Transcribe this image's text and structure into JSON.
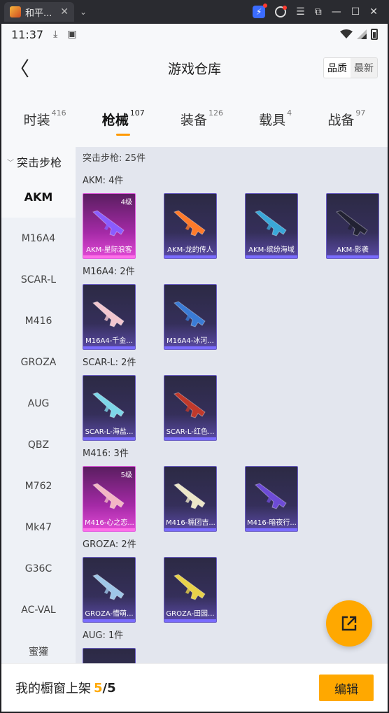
{
  "window": {
    "tab_title": "和平...",
    "tab_close": "✕",
    "tab_dropdown": "⌄"
  },
  "status_bar": {
    "time": "11:37"
  },
  "header": {
    "title": "游戏仓库",
    "back_glyph": "〈",
    "sort_options": [
      "品质",
      "最新"
    ],
    "sort_active": "品质"
  },
  "categories": [
    {
      "label": "时装",
      "count": "416"
    },
    {
      "label": "枪械",
      "count": "107",
      "active": true
    },
    {
      "label": "装备",
      "count": "126"
    },
    {
      "label": "载具",
      "count": "4"
    },
    {
      "label": "战备",
      "count": "97"
    }
  ],
  "sidebar": {
    "group": "突击步枪",
    "group_chevron": "﹀",
    "items": [
      "AKM",
      "M16A4",
      "SCAR-L",
      "M416",
      "GROZA",
      "AUG",
      "QBZ",
      "M762",
      "Mk47",
      "G36C",
      "AC-VAL",
      "蜜獾"
    ],
    "active": "AKM"
  },
  "content": {
    "section_title": "突击步枪: 25件",
    "groups": [
      {
        "title": "AKM: 4件",
        "cards": [
          {
            "name": "AKM-星际浪客",
            "level": "4级",
            "rarity": "pink",
            "gun_color": "#8a5cff"
          },
          {
            "name": "AKM-龙的传人",
            "level": "",
            "rarity": "purple",
            "gun_color": "#ff7a2a"
          },
          {
            "name": "AKM-缤纷海域",
            "level": "",
            "rarity": "purple",
            "gun_color": "#3aa7d8"
          },
          {
            "name": "AKM-影袭",
            "level": "",
            "rarity": "purple",
            "gun_color": "#222233"
          }
        ]
      },
      {
        "title": "M16A4: 2件",
        "cards": [
          {
            "name": "M16A4-千金...",
            "level": "",
            "rarity": "purple",
            "gun_color": "#f2c6cf"
          },
          {
            "name": "M16A4-冰河...",
            "level": "",
            "rarity": "purple",
            "gun_color": "#3a7bd5"
          }
        ]
      },
      {
        "title": "SCAR-L: 2件",
        "cards": [
          {
            "name": "SCAR-L-海盐...",
            "level": "",
            "rarity": "purple",
            "gun_color": "#7ed6e8"
          },
          {
            "name": "SCAR-L-红色...",
            "level": "",
            "rarity": "purple",
            "gun_color": "#c0392b"
          }
        ]
      },
      {
        "title": "M416: 3件",
        "cards": [
          {
            "name": "M416-心之恋...",
            "level": "5级",
            "rarity": "pink",
            "gun_color": "#f3b7c4"
          },
          {
            "name": "M416-糯团吉...",
            "level": "",
            "rarity": "purple",
            "gun_color": "#ece6c8"
          },
          {
            "name": "M416-暗夜行...",
            "level": "",
            "rarity": "purple",
            "gun_color": "#6d4bd6"
          }
        ]
      },
      {
        "title": "GROZA: 2件",
        "cards": [
          {
            "name": "GROZA-懵萌...",
            "level": "",
            "rarity": "purple",
            "gun_color": "#9fc7e8"
          },
          {
            "name": "GROZA-田园...",
            "level": "",
            "rarity": "purple",
            "gun_color": "#e8d24a"
          }
        ]
      },
      {
        "title": "AUG: 1件",
        "cards": [
          {
            "name": "",
            "level": "",
            "rarity": "purple",
            "gun_color": "#8888aa"
          }
        ]
      }
    ]
  },
  "bottom_bar": {
    "shelf_label": "我的橱窗上架",
    "shelf_count": "5",
    "shelf_total": "/5",
    "edit_label": "编辑"
  },
  "colors": {
    "accent": "#ffa800",
    "active_underline": "#ff9900"
  }
}
